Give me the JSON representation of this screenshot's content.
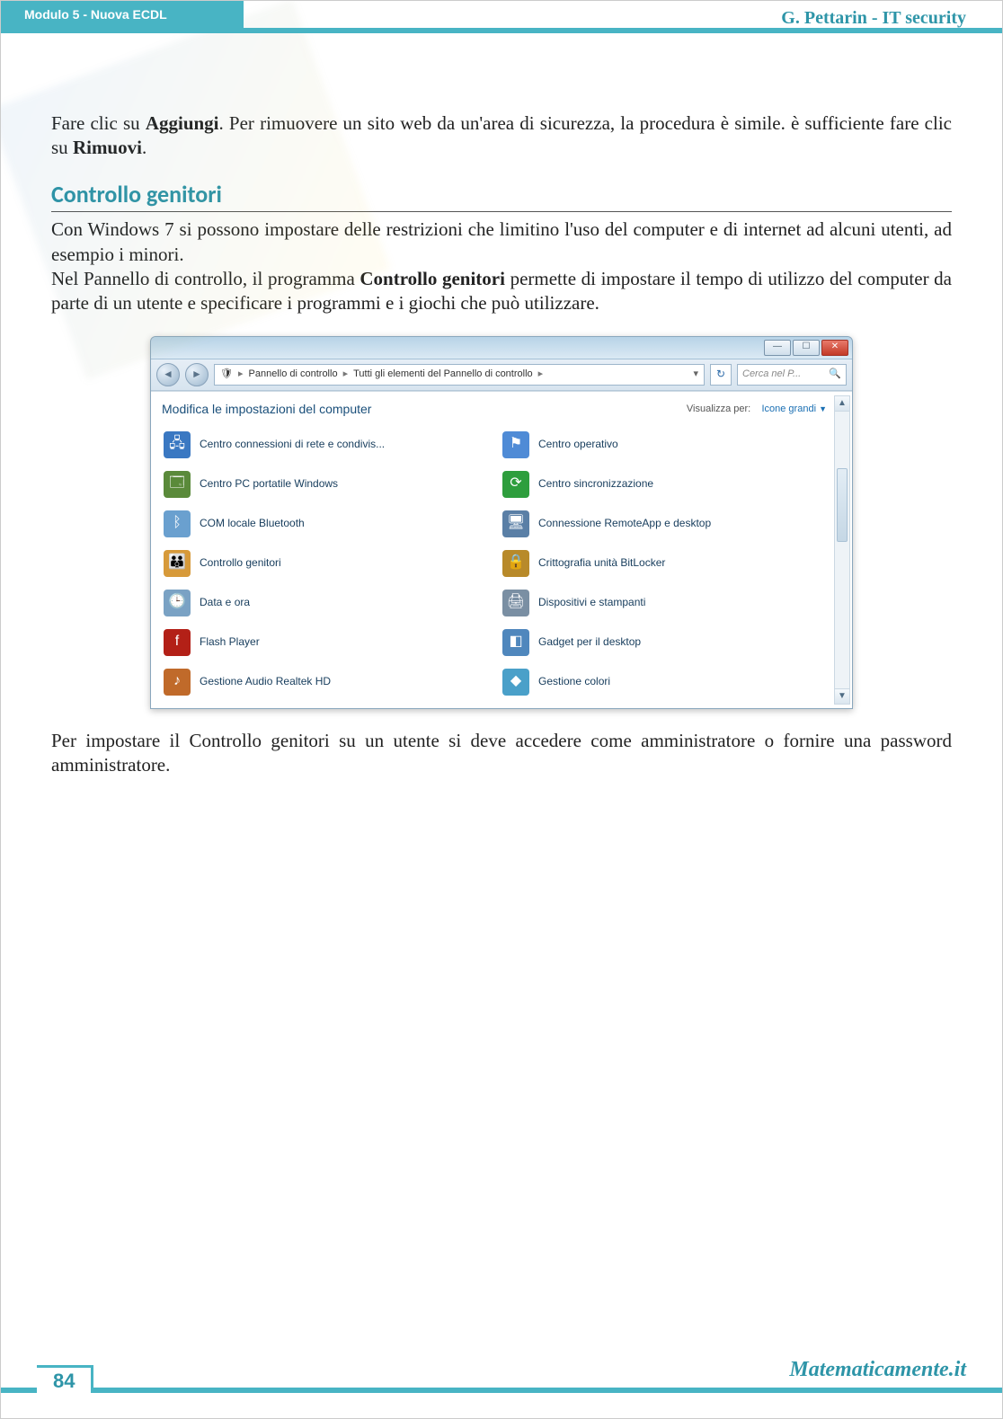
{
  "header": {
    "left": "Modulo 5 - Nuova ECDL",
    "right": "G. Pettarin - IT security"
  },
  "para1_a": "Fare clic su ",
  "para1_b": "Aggiungi",
  "para1_c": ". Per rimuovere un sito web da un'area di sicurezza, la procedura è simile. è sufficiente fare clic su ",
  "para1_d": "Rimuovi",
  "para1_e": ".",
  "section_title": "Controllo genitori",
  "para2": "Con Windows 7 si possono impostare delle restrizioni che limitino l'uso del computer e di internet ad alcuni utenti, ad esempio i minori.",
  "para3_a": "Nel Pannello di controllo, il programma ",
  "para3_b": "Controllo genitori",
  "para3_c": " permette di impostare il tempo di utilizzo del computer da parte di un utente e specificare i programmi e i giochi che può utilizzare.",
  "window": {
    "breadcrumb1": "Pannello di controllo",
    "breadcrumb2": "Tutti gli elementi del Pannello di controllo",
    "search_placeholder": "Cerca nel P...",
    "heading": "Modifica le impostazioni del computer",
    "view_label": "Visualizza per:",
    "view_value": "Icone grandi",
    "items": [
      {
        "label": "Centro connessioni di rete e condivis...",
        "icon": "🖧",
        "bg": "#3a78c2"
      },
      {
        "label": "Centro operativo",
        "icon": "⚑",
        "bg": "#4f8bd6"
      },
      {
        "label": "Centro PC portatile Windows",
        "icon": "🗔",
        "bg": "#5a8a3a"
      },
      {
        "label": "Centro sincronizzazione",
        "icon": "⟳",
        "bg": "#2e9e3d"
      },
      {
        "label": "COM locale Bluetooth",
        "icon": "ᛒ",
        "bg": "#6aa0cf"
      },
      {
        "label": "Connessione RemoteApp e desktop",
        "icon": "🖥",
        "bg": "#5a7fa6"
      },
      {
        "label": "Controllo genitori",
        "icon": "👪",
        "bg": "#d79a3a"
      },
      {
        "label": "Crittografia unità BitLocker",
        "icon": "🔒",
        "bg": "#b88a2a"
      },
      {
        "label": "Data e ora",
        "icon": "🕒",
        "bg": "#7aa2c4"
      },
      {
        "label": "Dispositivi e stampanti",
        "icon": "🖨",
        "bg": "#7a8fa3"
      },
      {
        "label": "Flash Player",
        "icon": "f",
        "bg": "#b32017"
      },
      {
        "label": "Gadget per il desktop",
        "icon": "◧",
        "bg": "#4f87bd"
      },
      {
        "label": "Gestione Audio Realtek HD",
        "icon": "♪",
        "bg": "#c06a2a"
      },
      {
        "label": "Gestione colori",
        "icon": "◆",
        "bg": "#4aa0c9"
      }
    ]
  },
  "para4": "Per impostare il Controllo genitori su un utente si deve accedere come amministratore o fornire una password amministratore.",
  "footer": {
    "page": "84",
    "site": "Matematicamente.it"
  }
}
